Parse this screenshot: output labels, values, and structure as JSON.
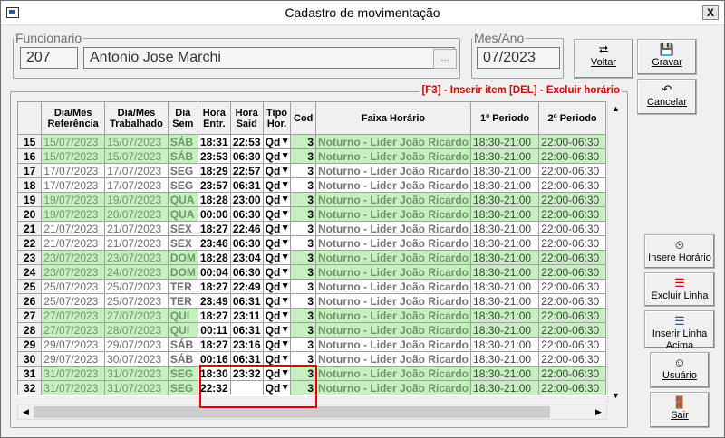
{
  "window": {
    "title": "Cadastro de movimentação",
    "close": "X"
  },
  "funcionario": {
    "legend": "Funcionario",
    "code": "207",
    "name": "Antonio Jose Marchi",
    "lookup": "..."
  },
  "mesano": {
    "legend": "Mes/Ano",
    "value": "07/2023"
  },
  "buttons": {
    "voltar": "Voltar",
    "gravar": "Gravar",
    "cancelar": "Cancelar",
    "insere_horario": "Insere Horário",
    "excluir_linha": "Excluir Linha",
    "inserir_linha_acima": "Inserir Linha Acima",
    "usuario": "Usuário",
    "sair": "Sair"
  },
  "hint": "[F3] - Inserir item [DEL] - Excluir horário",
  "columns": [
    "Dia/Mes Referência",
    "Dia/Mes Trabalhado",
    "Dia Sem",
    "Hora Entr.",
    "Hora Said",
    "Tipo Hor.",
    "Cod",
    "Faixa Horário",
    "1º Periodo",
    "2º Periodo"
  ],
  "rows": [
    {
      "n": "15",
      "ref": "15/07/2023",
      "trab": "15/07/2023",
      "sem": "SÁB",
      "ent": "18:31",
      "sai": "22:53",
      "tipo": "Qd",
      "cod": "3",
      "faixa": "Noturno - Lider João Ricardo",
      "p1": "18:30-21:00",
      "p2": "22:00-06:30",
      "color": "g"
    },
    {
      "n": "16",
      "ref": "15/07/2023",
      "trab": "15/07/2023",
      "sem": "SÁB",
      "ent": "23:53",
      "sai": "06:30",
      "tipo": "Qd",
      "cod": "3",
      "faixa": "Noturno - Lider João Ricardo",
      "p1": "18:30-21:00",
      "p2": "22:00-06:30",
      "color": "g"
    },
    {
      "n": "17",
      "ref": "17/07/2023",
      "trab": "17/07/2023",
      "sem": "SEG",
      "ent": "18:29",
      "sai": "22:57",
      "tipo": "Qd",
      "cod": "3",
      "faixa": "Noturno - Lider João Ricardo",
      "p1": "18:30-21:00",
      "p2": "22:00-06:30",
      "color": "w"
    },
    {
      "n": "18",
      "ref": "17/07/2023",
      "trab": "17/07/2023",
      "sem": "SEG",
      "ent": "23:57",
      "sai": "06:31",
      "tipo": "Qd",
      "cod": "3",
      "faixa": "Noturno - Lider João Ricardo",
      "p1": "18:30-21:00",
      "p2": "22:00-06:30",
      "color": "w"
    },
    {
      "n": "19",
      "ref": "19/07/2023",
      "trab": "19/07/2023",
      "sem": "QUA",
      "ent": "18:28",
      "sai": "23:00",
      "tipo": "Qd",
      "cod": "3",
      "faixa": "Noturno - Lider João Ricardo",
      "p1": "18:30-21:00",
      "p2": "22:00-06:30",
      "color": "g"
    },
    {
      "n": "20",
      "ref": "19/07/2023",
      "trab": "20/07/2023",
      "sem": "QUA",
      "ent": "00:00",
      "sai": "06:30",
      "tipo": "Qd",
      "cod": "3",
      "faixa": "Noturno - Lider João Ricardo",
      "p1": "18:30-21:00",
      "p2": "22:00-06:30",
      "color": "g"
    },
    {
      "n": "21",
      "ref": "21/07/2023",
      "trab": "21/07/2023",
      "sem": "SEX",
      "ent": "18:27",
      "sai": "22:46",
      "tipo": "Qd",
      "cod": "3",
      "faixa": "Noturno - Lider João Ricardo",
      "p1": "18:30-21:00",
      "p2": "22:00-06:30",
      "color": "w"
    },
    {
      "n": "22",
      "ref": "21/07/2023",
      "trab": "21/07/2023",
      "sem": "SEX",
      "ent": "23:46",
      "sai": "06:30",
      "tipo": "Qd",
      "cod": "3",
      "faixa": "Noturno - Lider João Ricardo",
      "p1": "18:30-21:00",
      "p2": "22:00-06:30",
      "color": "w"
    },
    {
      "n": "23",
      "ref": "23/07/2023",
      "trab": "23/07/2023",
      "sem": "DOM",
      "ent": "18:28",
      "sai": "23:04",
      "tipo": "Qd",
      "cod": "3",
      "faixa": "Noturno - Lider João Ricardo",
      "p1": "18:30-21:00",
      "p2": "22:00-06:30",
      "color": "g"
    },
    {
      "n": "24",
      "ref": "23/07/2023",
      "trab": "24/07/2023",
      "sem": "DOM",
      "ent": "00:04",
      "sai": "06:30",
      "tipo": "Qd",
      "cod": "3",
      "faixa": "Noturno - Lider João Ricardo",
      "p1": "18:30-21:00",
      "p2": "22:00-06:30",
      "color": "g"
    },
    {
      "n": "25",
      "ref": "25/07/2023",
      "trab": "25/07/2023",
      "sem": "TER",
      "ent": "18:27",
      "sai": "22:49",
      "tipo": "Qd",
      "cod": "3",
      "faixa": "Noturno - Lider João Ricardo",
      "p1": "18:30-21:00",
      "p2": "22:00-06:30",
      "color": "w"
    },
    {
      "n": "26",
      "ref": "25/07/2023",
      "trab": "25/07/2023",
      "sem": "TER",
      "ent": "23:49",
      "sai": "06:31",
      "tipo": "Qd",
      "cod": "3",
      "faixa": "Noturno - Lider João Ricardo",
      "p1": "18:30-21:00",
      "p2": "22:00-06:30",
      "color": "w"
    },
    {
      "n": "27",
      "ref": "27/07/2023",
      "trab": "27/07/2023",
      "sem": "QUI",
      "ent": "18:27",
      "sai": "23:11",
      "tipo": "Qd",
      "cod": "3",
      "faixa": "Noturno - Lider João Ricardo",
      "p1": "18:30-21:00",
      "p2": "22:00-06:30",
      "color": "g"
    },
    {
      "n": "28",
      "ref": "27/07/2023",
      "trab": "28/07/2023",
      "sem": "QUI",
      "ent": "00:11",
      "sai": "06:31",
      "tipo": "Qd",
      "cod": "3",
      "faixa": "Noturno - Lider João Ricardo",
      "p1": "18:30-21:00",
      "p2": "22:00-06:30",
      "color": "g"
    },
    {
      "n": "29",
      "ref": "29/07/2023",
      "trab": "29/07/2023",
      "sem": "SÁB",
      "ent": "18:27",
      "sai": "23:16",
      "tipo": "Qd",
      "cod": "3",
      "faixa": "Noturno - Lider João Ricardo",
      "p1": "18:30-21:00",
      "p2": "22:00-06:30",
      "color": "w"
    },
    {
      "n": "30",
      "ref": "29/07/2023",
      "trab": "30/07/2023",
      "sem": "SÁB",
      "ent": "00:16",
      "sai": "06:31",
      "tipo": "Qd",
      "cod": "3",
      "faixa": "Noturno - Lider João Ricardo",
      "p1": "18:30-21:00",
      "p2": "22:00-06:30",
      "color": "w"
    },
    {
      "n": "31",
      "ref": "31/07/2023",
      "trab": "31/07/2023",
      "sem": "SEG",
      "ent": "18:30",
      "sai": "23:32",
      "tipo": "Qd",
      "cod": "3",
      "faixa": "Noturno - Lider João Ricardo",
      "p1": "18:30-21:00",
      "p2": "22:00-06:30",
      "color": "g"
    },
    {
      "n": "32",
      "ref": "31/07/2023",
      "trab": "31/07/2023",
      "sem": "SEG",
      "ent": "22:32",
      "sai": "",
      "tipo": "Qd",
      "cod": "3",
      "faixa": "Noturno - Lider João Ricardo",
      "p1": "18:30-21:00",
      "p2": "22:00-06:30",
      "color": "g"
    }
  ],
  "colors": {
    "green_row": "#c6f0c0",
    "highlight": "#e00000",
    "hint": "#e00000"
  }
}
